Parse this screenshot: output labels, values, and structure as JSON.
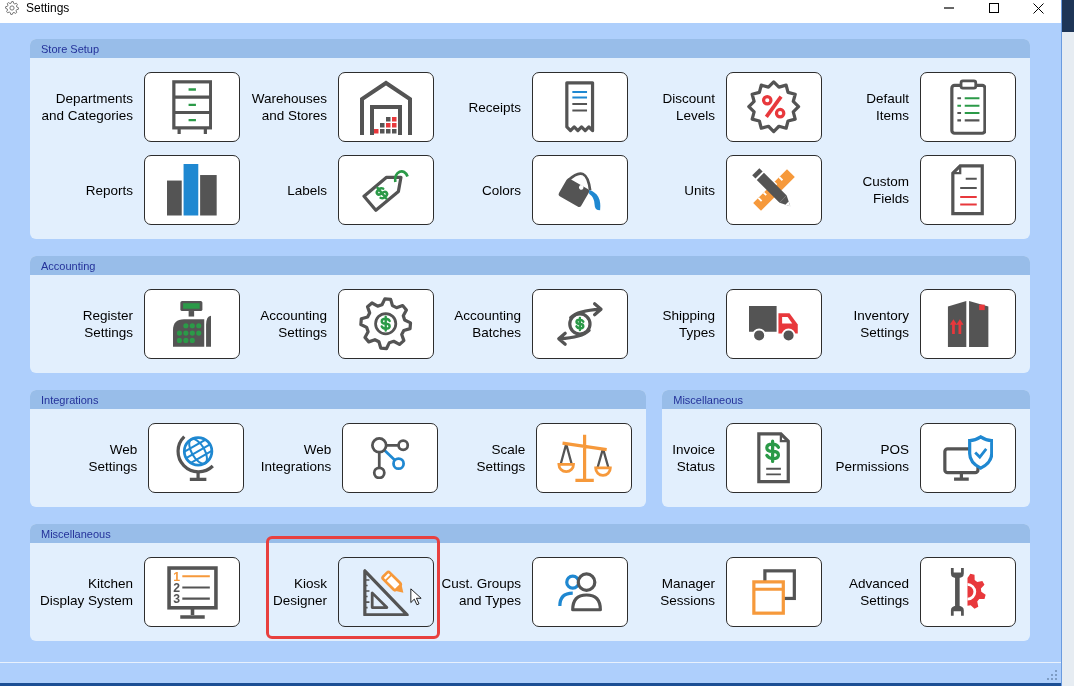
{
  "window": {
    "title": "Settings"
  },
  "rows": [
    {
      "panels": [
        {
          "title": "Store Setup",
          "items": [
            {
              "label": "Departments\nand Categories",
              "hovered": false,
              "highlighted": false
            },
            {
              "label": "Warehouses\nand Stores",
              "hovered": false,
              "highlighted": false
            },
            {
              "label": "Receipts",
              "hovered": false,
              "highlighted": false
            },
            {
              "label": "Discount\nLevels",
              "hovered": false,
              "highlighted": false
            },
            {
              "label": "Default\nItems",
              "hovered": false,
              "highlighted": false
            },
            {
              "label": "Reports",
              "hovered": false,
              "highlighted": false
            },
            {
              "label": "Labels",
              "hovered": false,
              "highlighted": false
            },
            {
              "label": "Colors",
              "hovered": false,
              "highlighted": false
            },
            {
              "label": "Units",
              "hovered": false,
              "highlighted": false
            },
            {
              "label": "Custom\nFields",
              "hovered": false,
              "highlighted": false
            }
          ]
        }
      ]
    },
    {
      "panels": [
        {
          "title": "Accounting",
          "items": [
            {
              "label": "Register\nSettings",
              "hovered": false,
              "highlighted": false
            },
            {
              "label": "Accounting\nSettings",
              "hovered": false,
              "highlighted": false
            },
            {
              "label": "Accounting\nBatches",
              "hovered": false,
              "highlighted": false
            },
            {
              "label": "Shipping\nTypes",
              "hovered": false,
              "highlighted": false
            },
            {
              "label": "Inventory\nSettings",
              "hovered": false,
              "highlighted": false
            }
          ]
        }
      ]
    },
    {
      "panels": [
        {
          "title": "Integrations",
          "items": [
            {
              "label": "Web\nSettings",
              "hovered": false,
              "highlighted": false
            },
            {
              "label": "Web\nIntegrations",
              "hovered": false,
              "highlighted": false
            },
            {
              "label": "Scale\nSettings",
              "hovered": false,
              "highlighted": false
            }
          ]
        },
        {
          "title": "Miscellaneous",
          "items": [
            {
              "label": "Invoice\nStatus",
              "hovered": false,
              "highlighted": false
            },
            {
              "label": "POS\nPermissions",
              "hovered": false,
              "highlighted": false
            }
          ]
        }
      ]
    },
    {
      "panels": [
        {
          "title": "Miscellaneous",
          "items": [
            {
              "label": "Kitchen\nDisplay System",
              "icon_numbers": [
                "1",
                "2",
                "3"
              ],
              "hovered": false,
              "highlighted": false
            },
            {
              "label": "Kiosk\nDesigner",
              "hovered": true,
              "highlighted": true
            },
            {
              "label": "Cust. Groups\nand Types",
              "hovered": false,
              "highlighted": false
            },
            {
              "label": "Manager\nSessions",
              "hovered": false,
              "highlighted": false
            },
            {
              "label": "Advanced\nSettings",
              "hovered": false,
              "highlighted": false
            }
          ]
        }
      ]
    }
  ]
}
